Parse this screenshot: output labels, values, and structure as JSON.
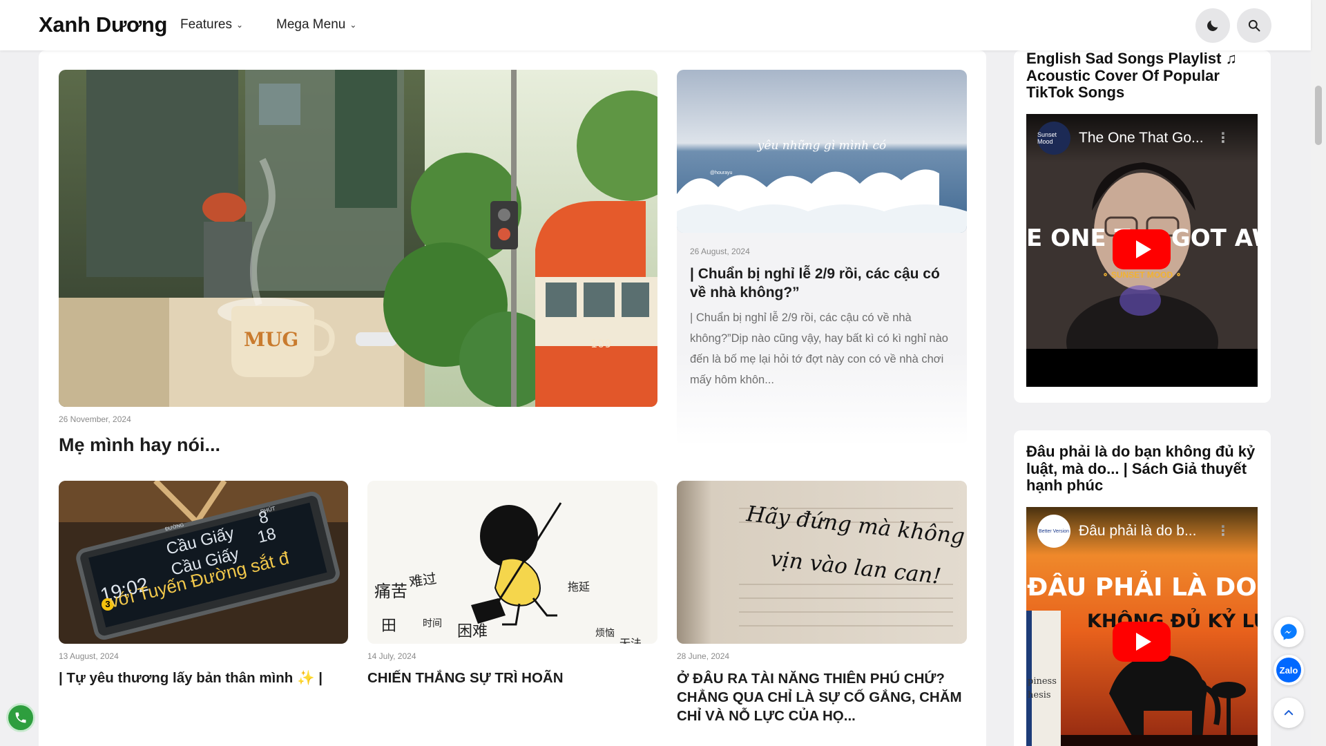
{
  "header": {
    "logo": "Xanh Dương",
    "nav": [
      {
        "label": "Features"
      },
      {
        "label": "Mega Menu"
      }
    ]
  },
  "featured": {
    "date": "26 November, 2024",
    "title": "Mẹ mình hay nói..."
  },
  "secondary": {
    "image_caption": "yêu những gì mình có",
    "image_handle": "@hourayu",
    "date": "26 August, 2024",
    "title": "| Chuẩn bị nghỉ lễ 2/9 rồi, các cậu có về nhà không?”",
    "excerpt": "| Chuẩn bị nghỉ lễ 2/9 rồi, các cậu có về nhà không?”Dịp nào cũng vậy, hay bất kì có kì nghỉ nào đến là bố mẹ lại hỏi tớ đợt này con có về nhà chơi mấy hôm khôn..."
  },
  "posts": [
    {
      "date": "13 August, 2024",
      "title": "| Tự yêu thương lấy bản thân mình ✨ |",
      "board_phut": "PHÚT",
      "board_time": "19:02",
      "board_line1": "Cầu Giấy",
      "board_line2": "Cầu Giấy",
      "board_n1": "8",
      "board_n2": "18",
      "board_scroll": "với Tuyến Đường sắt đ",
      "board_num": "3",
      "board_vach": "ĐƯỜNG"
    },
    {
      "date": "14 July, 2024",
      "title": "CHIẾN THẮNG SỰ TRÌ HOÃN",
      "chars": [
        "痛苦",
        "难过",
        "困难",
        "拖延",
        "田",
        "时间",
        "烦恼",
        "无法"
      ]
    },
    {
      "date": "28 June, 2024",
      "title": "Ở ĐÂU RA TÀI NĂNG THIÊN PHÚ CHỨ? CHẲNG QUA CHỈ LÀ SỰ CỐ GẮNG, CHĂM CHỈ VÀ NỖ LỰC CỦA HỌ...",
      "hand_line1": "Hãy đứng mà không cần",
      "hand_line2": "vịn vào lan can!"
    }
  ],
  "sidebar": [
    {
      "title": "English Sad Songs Playlist ♫ Acoustic Cover Of Popular TikTok Songs",
      "video_title": "The One That Go...",
      "avatar_text": "Sunset Mood",
      "overlay_text": "E ONE T     GOT AW",
      "overlay_sub": "⚬ SUNSET MOOD ⚬"
    },
    {
      "title": "Đâu phải là do bạn không đủ kỷ luật, mà do... | Sách Giả thuyết hạnh phúc",
      "video_title": "Đâu phải là do b...",
      "avatar_text": "Better Version",
      "overlay_line1": "ĐÂU PHẢI LÀ DO",
      "overlay_line2": "KHÔNG ĐỦ KỶ LU",
      "book_text1": "piness",
      "book_text2": "hesis"
    }
  ],
  "floating": {
    "zalo_label": "Zalo"
  },
  "colors": {
    "play_red": "#ff0000",
    "phone_green": "#2e9e3e",
    "zalo_blue": "#0068ff",
    "messenger_blue": "#0a7cff"
  }
}
